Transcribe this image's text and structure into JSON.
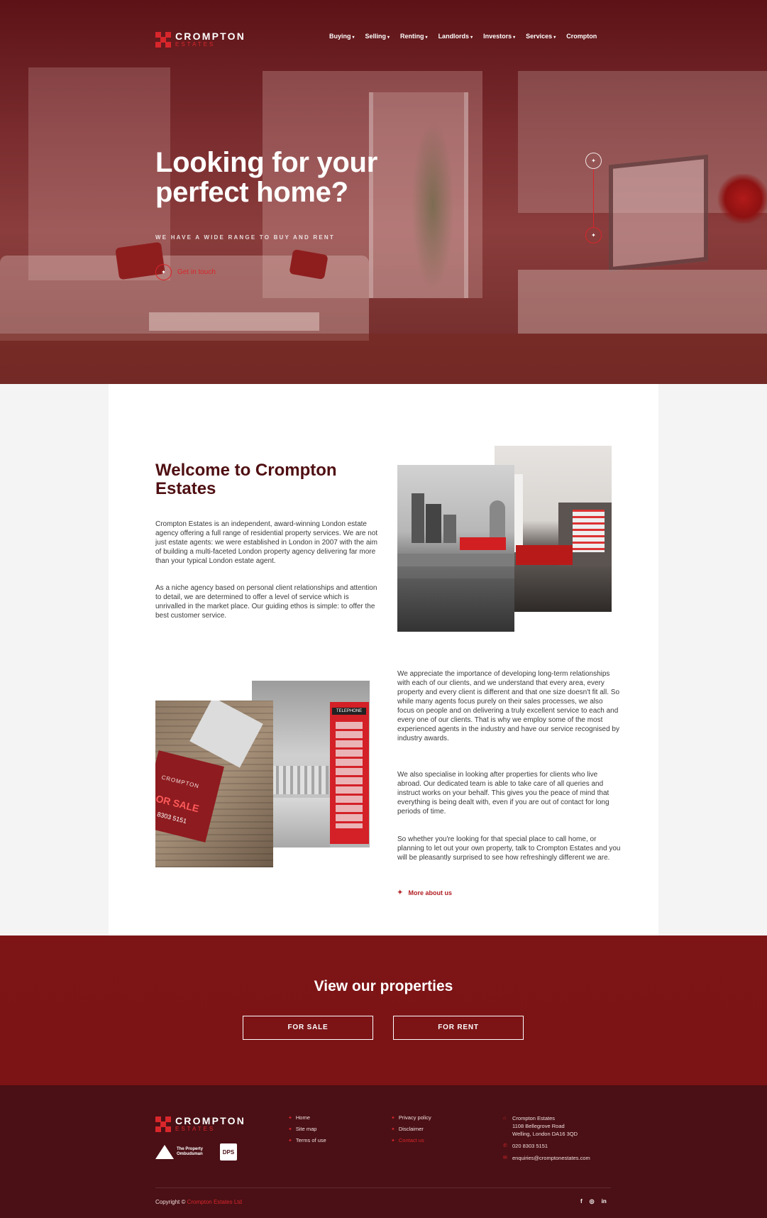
{
  "logo": {
    "main": "CROMPTON",
    "sub": "ESTATES"
  },
  "nav": [
    {
      "label": "Buying",
      "has_caret": true
    },
    {
      "label": "Selling",
      "has_caret": true
    },
    {
      "label": "Renting",
      "has_caret": true
    },
    {
      "label": "Landlords",
      "has_caret": true
    },
    {
      "label": "Investors",
      "has_caret": true
    },
    {
      "label": "Services",
      "has_caret": true
    },
    {
      "label": "Crompton",
      "has_caret": false
    }
  ],
  "hero": {
    "title": "Looking for your perfect home?",
    "subtitle": "WE HAVE A WIDE RANGE TO BUY AND RENT",
    "cta": "Get in touch"
  },
  "welcome": {
    "title": "Welcome to Crompton Estates",
    "p1": "Crompton Estates is an independent, award-winning London estate agency offering a full range of residential property services.  We are not just estate agents: we were established in London in 2007 with the aim of building a multi-faceted London property agency delivering far more than your typical London estate agent.",
    "p2": "As a niche agency based on personal client relationships and attention to detail, we are determined to offer a level of service which is unrivalled in the market place.  Our guiding ethos is simple: to offer the best customer service.",
    "p3": "We appreciate the importance of developing long-term relationships with each of our clients, and we understand that every area, every property and every client is different and that one size doesn't fit all.  So while many agents focus purely on their sales processes, we also focus on people and on delivering a truly excellent service to each and every one of our clients.  That is why we employ some of the most experienced agents in the industry and have our service recognised by industry awards.",
    "p4": "We also specialise in looking after properties for clients who live abroad.  Our dedicated team is able to take care of all queries and instruct works on your behalf.  This gives you the peace of mind that everything is being dealt with, even if you are out of contact for long periods of time.",
    "p5": "So whether you're looking for that special place to call home, or planning to let out your own property, talk to Crompton Estates and you will be pleasantly surprised to see how refreshingly different we are.",
    "more": "More about us"
  },
  "images": {
    "sign_text_1": "CROMPTON",
    "sign_text_2": "OR SALE",
    "sign_text_3": "8303 5151",
    "booth_label": "TELEPHONE"
  },
  "properties": {
    "title": "View our properties",
    "for_sale": "FOR SALE",
    "for_rent": "FOR RENT"
  },
  "footer": {
    "links_col1": [
      "Home",
      "Site map",
      "Terms of use"
    ],
    "links_col2": [
      "Privacy policy",
      "Disclaimer",
      "Contact us"
    ],
    "address_lines": [
      "Crompton Estates",
      "1108 Bellegrove Road",
      "Welling, London DA16 3QD"
    ],
    "phone": "020 8303 5151",
    "email": "enquiries@cromptonestates.com",
    "tpo_line1": "The Property",
    "tpo_line2": "Ombudsman",
    "dps": "DPS",
    "copyright_prefix": "Copyright ©",
    "copyright_name": "Crompton Estates Ltd",
    "social": [
      "f",
      "◎",
      "in"
    ]
  },
  "colors": {
    "accent": "#d8262b",
    "dark": "#4f0f12",
    "banner": "#7d1517",
    "footer": "#4a1015"
  }
}
